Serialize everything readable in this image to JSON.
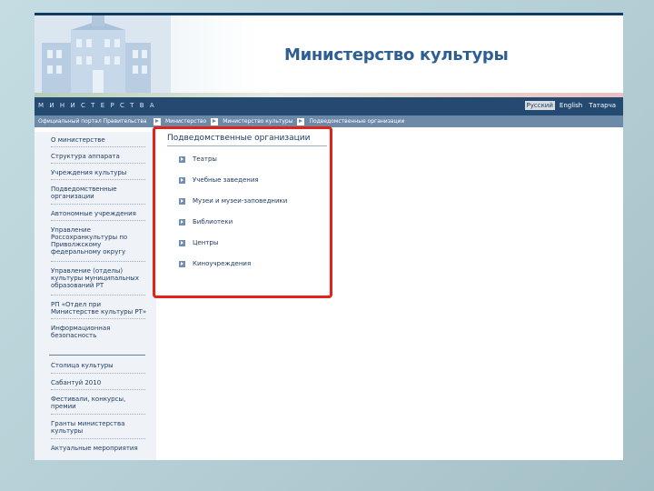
{
  "header": {
    "site_title": "Министерство культуры",
    "menu_word": "МИНИСТЕРСТВА"
  },
  "languages": [
    "Русский",
    "English",
    "Татарча"
  ],
  "active_language": "Русский",
  "breadcrumb": {
    "portal": "Официальный портал Правительства",
    "items": [
      "Министерство",
      "Министерство культуры",
      "Подведомственные организации"
    ]
  },
  "sidebar": {
    "items": [
      "О министерстве",
      "Структура аппарата",
      "Учреждения культуры",
      "Подведомственные организации",
      "Автономные учреждения",
      "Управление Россохранкультуры по Приволжскому федеральному округу",
      "Управление (отделы) культуры муниципальных образований РТ",
      "РП «Отдел при Министерстве культуры РТ»",
      "Информационная безопасность",
      "Столица культуры",
      "Сабантуй 2010",
      "Фестивали, конкурсы, премии",
      "Гранты министерства культуры",
      "Актуальные мероприятия"
    ]
  },
  "main": {
    "section_title": "Подведомственные организации",
    "items": [
      "Театры",
      "Учебные заведения",
      "Музеи и музеи-заповедники",
      "Библиотеки",
      "Центры",
      "Киноучреждения"
    ]
  },
  "colors": {
    "header_bar": "#244a72",
    "breadcrumb_bar": "#6c8aa7",
    "title": "#2e5f93",
    "highlight_border": "#e2231a",
    "link": "#1e3c64"
  }
}
